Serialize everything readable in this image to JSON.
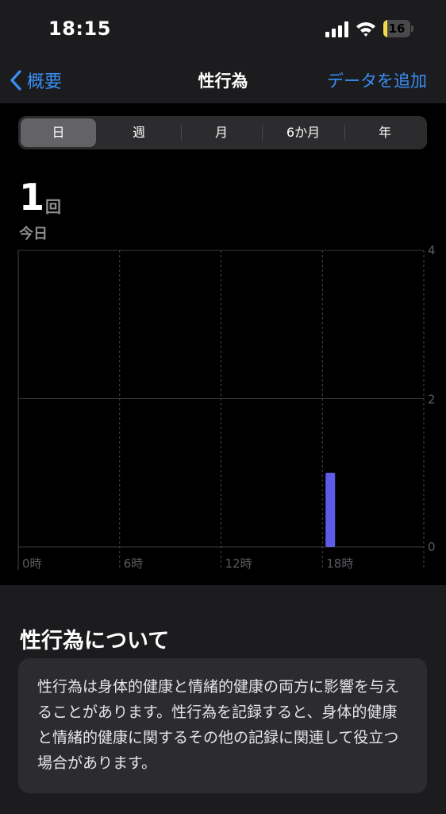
{
  "status_bar": {
    "time": "18:15",
    "battery_level": "16",
    "battery_fraction": 0.16
  },
  "nav": {
    "back_label": "概要",
    "title": "性行為",
    "add_data_label": "データを追加"
  },
  "segments": [
    {
      "label": "日",
      "active": true
    },
    {
      "label": "週",
      "active": false
    },
    {
      "label": "月",
      "active": false
    },
    {
      "label": "6か月",
      "active": false
    },
    {
      "label": "年",
      "active": false
    }
  ],
  "summary": {
    "value": "1",
    "unit": "回",
    "period": "今日"
  },
  "chart_data": {
    "type": "bar",
    "x_tick_labels": [
      "0時",
      "6時",
      "12時",
      "18時"
    ],
    "x_range_hours": [
      0,
      24
    ],
    "y_tick_labels": [
      "4",
      "2",
      "0"
    ],
    "ylim": [
      0,
      4
    ],
    "grid": true,
    "bar_color": "#5e5ce6",
    "points": [
      {
        "hour": 18,
        "value": 1
      }
    ]
  },
  "about": {
    "title": "性行為について",
    "text": "性行為は身体的健康と情緒的健康の両方に影響を与えることがあります。性行為を記録すると、身体的健康と情緒的健康に関するその他の記録に関連して役立つ場合があります。"
  },
  "colors": {
    "accent": "#3a8ef6",
    "background": "#000000",
    "panel": "#1c1c1e"
  }
}
